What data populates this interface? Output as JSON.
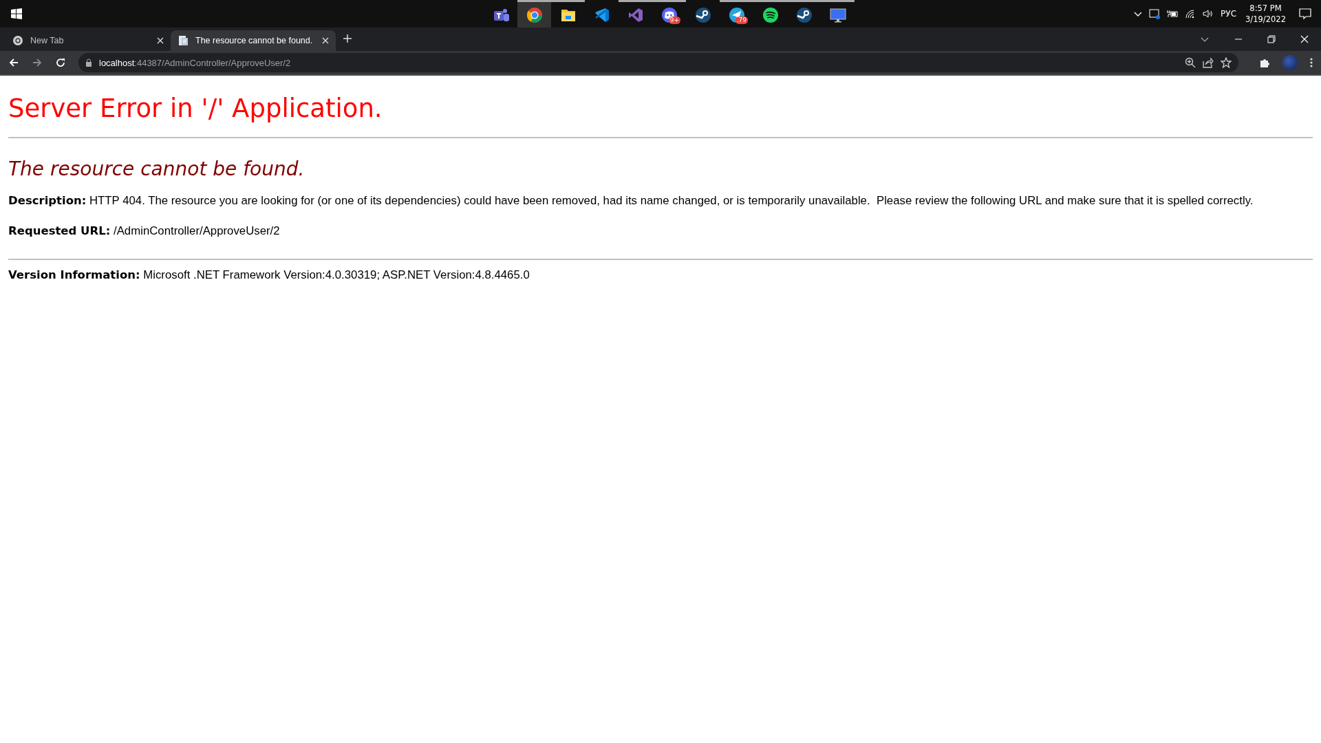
{
  "taskbar": {
    "apps": [
      {
        "kind": "teams",
        "running": false,
        "active": false
      },
      {
        "kind": "chrome",
        "running": true,
        "active": true
      },
      {
        "kind": "folder",
        "running": true,
        "active": false
      },
      {
        "kind": "vscode",
        "running": false,
        "active": false
      },
      {
        "kind": "vstudio",
        "running": true,
        "active": false
      },
      {
        "kind": "discord",
        "running": true,
        "active": false,
        "badge": "9+"
      },
      {
        "kind": "steam",
        "running": false,
        "active": false
      },
      {
        "kind": "telegram",
        "running": true,
        "active": false,
        "badge": ".79"
      },
      {
        "kind": "spotify",
        "running": true,
        "active": false
      },
      {
        "kind": "steam",
        "running": true,
        "active": false
      },
      {
        "kind": "monitor",
        "running": true,
        "active": false
      }
    ],
    "tray": {
      "language": "РУС",
      "time": "8:57 PM",
      "date": "3/19/2022"
    }
  },
  "browser": {
    "tabs": [
      {
        "title": "New Tab",
        "kind": "chrome",
        "selected": false
      },
      {
        "title": "The resource cannot be found.",
        "kind": "page",
        "selected": true
      }
    ],
    "address": {
      "host": "localhost",
      "path": ":44387/AdminController/ApproveUser/2"
    }
  },
  "page": {
    "title": "Server Error in '/' Application.",
    "heading": "The resource cannot be found.",
    "fields": [
      {
        "text": "**Description:** HTTP 404. The resource you are looking for (or one of its dependencies) could have been removed, had its name changed, or is temporarily unavailable.  Please review the following URL and make sure that it is spelled correctly."
      },
      {
        "text": "**Requested URL:** /AdminController/ApproveUser/2"
      }
    ],
    "version": "**Version Information:** Microsoft .NET Framework Version:4.0.30319; ASP.NET Version:4.8.4465.0"
  }
}
